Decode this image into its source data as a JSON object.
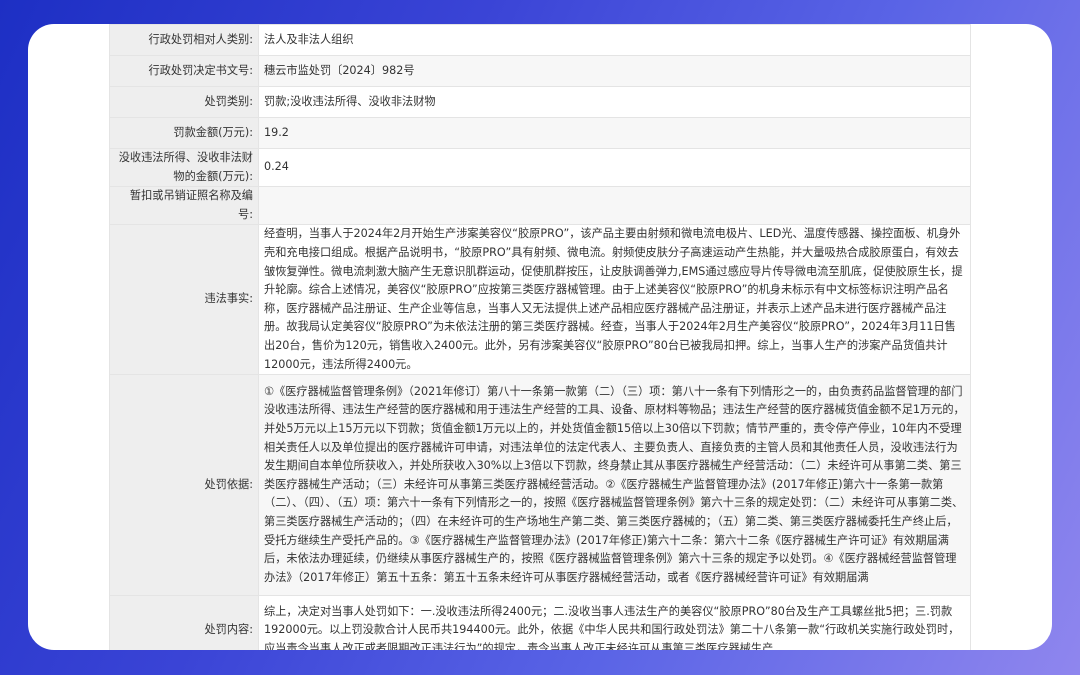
{
  "rows": [
    {
      "label": "行政处罚相对人类别:",
      "value": "法人及非法人组织"
    },
    {
      "label": "行政处罚决定书文号:",
      "value": "穗云市监处罚〔2024〕982号"
    },
    {
      "label": "处罚类别:",
      "value": "罚款;没收违法所得、没收非法财物"
    },
    {
      "label": "罚款金额(万元):",
      "value": "19.2"
    },
    {
      "label": "没收违法所得、没收非法财物的金额(万元):",
      "value": "0.24"
    },
    {
      "label": "暂扣或吊销证照名称及编号:",
      "value": ""
    },
    {
      "label": "违法事实:",
      "value": "经查明，当事人于2024年2月开始生产涉案美容仪“胶原PRO”，该产品主要由射频和微电流电极片、LED光、温度传感器、操控面板、机身外壳和充电接口组成。根据产品说明书，“胶原PRO”具有射频、微电流。射频使皮肤分子高速运动产生热能，并大量吸热合成胶原蛋白，有效去皱恢复弹性。微电流刺激大脑产生无意识肌群运动，促使肌群按压，让皮肤调善弹力,EMS通过感应导片传导微电流至肌底，促使胶原生长，提升轮廓。综合上述情况，美容仪“胶原PRO”应按第三类医疗器械管理。由于上述美容仪“胶原PRO”的机身未标示有中文标签标识注明产品名称，医疗器械产品注册证、生产企业等信息，当事人又无法提供上述产品相应医疗器械产品注册证，并表示上述产品未进行医疗器械产品注册。故我局认定美容仪“胶原PRO”为未依法注册的第三类医疗器械。经查，当事人于2024年2月生产美容仪“胶原PRO”，2024年3月11日售出20台，售价为120元，销售收入2400元。此外，另有涉案美容仪“胶原PRO”80台已被我局扣押。综上，当事人生产的涉案产品货值共计12000元，违法所得2400元。"
    },
    {
      "label": "处罚依据:",
      "value": "①《医疗器械监督管理条例》（2021年修订）第八十一条第一款第（二）（三）项：第八十一条有下列情形之一的，由负责药品监督管理的部门没收违法所得、违法生产经营的医疗器械和用于违法生产经营的工具、设备、原材料等物品；违法生产经营的医疗器械货值金额不足1万元的，并处5万元以上15万元以下罚款；货值金额1万元以上的，并处货值金额15倍以上30倍以下罚款；情节严重的，责令停产停业，10年内不受理相关责任人以及单位提出的医疗器械许可申请，对违法单位的法定代表人、主要负责人、直接负责的主管人员和其他责任人员，没收违法行为发生期间自本单位所获收入，并处所获收入30%以上3倍以下罚款，终身禁止其从事医疗器械生产经营活动：（二）未经许可从事第二类、第三类医疗器械生产活动；（三）未经许可从事第三类医疗器械经营活动。②《医疗器械生产监督管理办法》(2017年修正)第六十一条第一款第（二）、（四）、（五）项：第六十一条有下列情形之一的，按照《医疗器械监督管理条例》第六十三条的规定处罚：（二）未经许可从事第二类、第三类医疗器械生产活动的；（四）在未经许可的生产场地生产第二类、第三类医疗器械的；（五）第二类、第三类医疗器械委托生产终止后，受托方继续生产受托产品的。③《医疗器械生产监督管理办法》(2017年修正)第六十二条：第六十二条《医疗器械生产许可证》有效期届满后，未依法办理延续，仍继续从事医疗器械生产的，按照《医疗器械监督管理条例》第六十三条的规定予以处罚。④《医疗器械经营监督管理办法》（2017年修正）第五十五条：第五十五条未经许可从事医疗器械经营活动，或者《医疗器械经营许可证》有效期届满"
    },
    {
      "label": "处罚内容:",
      "value": "综上，决定对当事人处罚如下：一.没收违法所得2400元；二.没收当事人违法生产的美容仪“胶原PRO”80台及生产工具螺丝批5把；三.罚款192000元。以上罚没款合计人民币共194400元。此外，依据《中华人民共和国行政处罚法》第二十八条第一款“行政机关实施行政处罚时，应当责令当事人改正或者限期改正违法行为”的规定，责令当事人改正未经许可从事第三类医疗器械生产"
    }
  ]
}
